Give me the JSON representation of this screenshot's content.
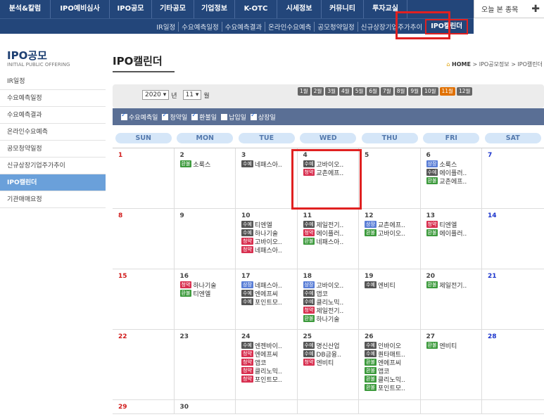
{
  "topnav": [
    {
      "label": "분석&칼럼"
    },
    {
      "label": "IPO예비심사"
    },
    {
      "label": "IPO공모"
    },
    {
      "label": "기타공모"
    },
    {
      "label": "기업정보"
    },
    {
      "label": "K-OTC"
    },
    {
      "label": "시세정보"
    },
    {
      "label": "커뮤니티"
    },
    {
      "label": "투자교실"
    }
  ],
  "recent": {
    "label": "오늘 본 종목",
    "plus": "✚"
  },
  "subnav": [
    "IR일정",
    "수요예측일정",
    "수요예측결과",
    "온라인수요예측",
    "공모청약일정",
    "신규상장기업주가추이",
    "IPO캘린더"
  ],
  "sidebar": {
    "title": "IPO공모",
    "subtitle": "INITIAL PUBLIC OFFERING",
    "items": [
      "IR일정",
      "수요예측일정",
      "수요예측결과",
      "온라인수요예측",
      "공모청약일정",
      "신규상장기업주가추이",
      "IPO캘린더",
      "기관매매요정"
    ],
    "active_index": 6,
    "arrow": "▼"
  },
  "main": {
    "title": "IPO캘린더",
    "breadcrumb": {
      "home": "HOME",
      "rest": "> IPO공모정보 > IPO캘린더"
    },
    "year": "2020 ▾",
    "year_unit": "년",
    "month": "11 ▾",
    "month_unit": "월",
    "months": [
      "1월",
      "2월",
      "3월",
      "4월",
      "5월",
      "6월",
      "7월",
      "8월",
      "9월",
      "10월",
      "11월",
      "12월"
    ],
    "active_month": 10,
    "legend": [
      {
        "label": "수요예측일",
        "checked": true
      },
      {
        "label": "청약일",
        "checked": true
      },
      {
        "label": "환불일",
        "checked": true
      },
      {
        "label": "납입일",
        "checked": false
      },
      {
        "label": "상장일",
        "checked": true
      }
    ],
    "dow": [
      "SUN",
      "MON",
      "TUE",
      "WED",
      "THU",
      "FRI",
      "SAT"
    ]
  },
  "calendar": [
    [
      {
        "d": "1",
        "c": "sun",
        "ev": []
      },
      {
        "d": "2",
        "ev": [
          {
            "t": "환불",
            "n": "소룩스"
          }
        ]
      },
      {
        "d": "3",
        "ev": [
          {
            "t": "수예",
            "n": "네패스아.."
          }
        ]
      },
      {
        "d": "4",
        "ev": [
          {
            "t": "수예",
            "n": "고바이오.."
          },
          {
            "t": "청약",
            "n": "교촌에프.."
          }
        ]
      },
      {
        "d": "5",
        "ev": []
      },
      {
        "d": "6",
        "ev": [
          {
            "t": "상장",
            "n": "소룩스"
          },
          {
            "t": "수예",
            "n": "에이플러.."
          },
          {
            "t": "환불",
            "n": "교촌에프.."
          }
        ]
      },
      {
        "d": "7",
        "c": "sat",
        "ev": []
      }
    ],
    [
      {
        "d": "8",
        "c": "sun",
        "ev": []
      },
      {
        "d": "9",
        "ev": []
      },
      {
        "d": "10",
        "ev": [
          {
            "t": "수예",
            "n": "티엔엘"
          },
          {
            "t": "수예",
            "n": "하나기술"
          },
          {
            "t": "청약",
            "n": "고바이오.."
          },
          {
            "t": "청약",
            "n": "네패스아.."
          }
        ]
      },
      {
        "d": "11",
        "ev": [
          {
            "t": "수예",
            "n": "제일전기.."
          },
          {
            "t": "청약",
            "n": "에이플러.."
          },
          {
            "t": "환불",
            "n": "네패스아.."
          }
        ]
      },
      {
        "d": "12",
        "ev": [
          {
            "t": "상장",
            "n": "교촌에프.."
          },
          {
            "t": "환불",
            "n": "고바이오.."
          }
        ]
      },
      {
        "d": "13",
        "ev": [
          {
            "t": "청약",
            "n": "티엔엘"
          },
          {
            "t": "환불",
            "n": "에이플러.."
          }
        ]
      },
      {
        "d": "14",
        "c": "sat",
        "ev": []
      }
    ],
    [
      {
        "d": "15",
        "c": "sun",
        "ev": []
      },
      {
        "d": "16",
        "ev": [
          {
            "t": "청약",
            "n": "하나기술"
          },
          {
            "t": "환불",
            "n": "티엔엘"
          }
        ]
      },
      {
        "d": "17",
        "ev": [
          {
            "t": "상장",
            "n": "네패스아.."
          },
          {
            "t": "수예",
            "n": "엔에프씨"
          },
          {
            "t": "수예",
            "n": "포인트모.."
          }
        ]
      },
      {
        "d": "18",
        "ev": [
          {
            "t": "상장",
            "n": "고바이오.."
          },
          {
            "t": "수예",
            "n": "앱코"
          },
          {
            "t": "수예",
            "n": "클리노믹.."
          },
          {
            "t": "청약",
            "n": "제일전기.."
          },
          {
            "t": "환불",
            "n": "하나기술"
          }
        ]
      },
      {
        "d": "19",
        "ev": [
          {
            "t": "수예",
            "n": "엔비티"
          }
        ]
      },
      {
        "d": "20",
        "ev": [
          {
            "t": "환불",
            "n": "제일전기.."
          }
        ]
      },
      {
        "d": "21",
        "c": "sat",
        "ev": []
      }
    ],
    [
      {
        "d": "22",
        "c": "sun",
        "ev": []
      },
      {
        "d": "23",
        "ev": []
      },
      {
        "d": "24",
        "ev": [
          {
            "t": "수예",
            "n": "엔젠바이.."
          },
          {
            "t": "청약",
            "n": "엔에프씨"
          },
          {
            "t": "청약",
            "n": "앱코"
          },
          {
            "t": "청약",
            "n": "클리노믹.."
          },
          {
            "t": "청약",
            "n": "포인트모.."
          }
        ]
      },
      {
        "d": "25",
        "ev": [
          {
            "t": "수예",
            "n": "명신산업"
          },
          {
            "t": "수예",
            "n": "DB금융.."
          },
          {
            "t": "청약",
            "n": "엔비티"
          }
        ]
      },
      {
        "d": "26",
        "ev": [
          {
            "t": "수예",
            "n": "인바이오"
          },
          {
            "t": "수예",
            "n": "퀀타매트.."
          },
          {
            "t": "환불",
            "n": "엔에프씨"
          },
          {
            "t": "환불",
            "n": "앱코"
          },
          {
            "t": "환불",
            "n": "클리노믹.."
          },
          {
            "t": "환불",
            "n": "포인트모.."
          }
        ]
      },
      {
        "d": "27",
        "ev": [
          {
            "t": "환불",
            "n": "엔비티"
          }
        ]
      },
      {
        "d": "28",
        "c": "sat",
        "ev": []
      }
    ],
    [
      {
        "d": "29",
        "c": "sun",
        "ev": []
      },
      {
        "d": "30",
        "ev": []
      },
      {
        "d": "",
        "ev": []
      },
      {
        "d": "",
        "ev": []
      },
      {
        "d": "",
        "ev": []
      },
      {
        "d": "",
        "ev": []
      },
      {
        "d": "",
        "ev": []
      }
    ]
  ]
}
